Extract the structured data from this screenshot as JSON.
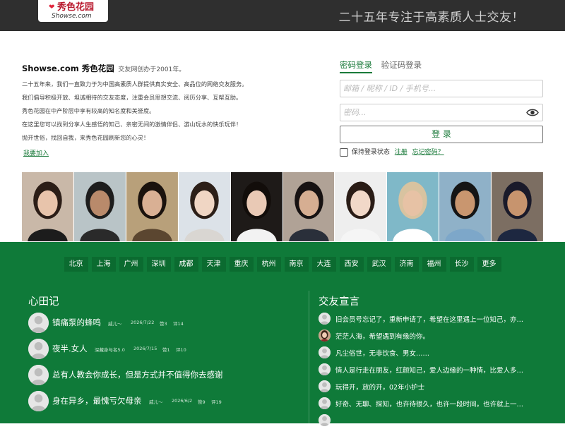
{
  "header": {
    "logo_cn": "秀色花园",
    "logo_en": "Showse.com",
    "slogan": "二十五年专注于高素质人士交友！"
  },
  "intro": {
    "title_bold": "Showse.com 秀色花园",
    "title_small": "交友网创办于2001年。",
    "paragraphs": [
      "二十五年来，我们一直致力于为中国高素质人群提供真实安全、高品位的网络交友服务。",
      "我们倡导积极开放、坦诚相待的交友态度，注重会员思想交流、阅历分享、互帮互助。",
      "秀色花园在中产阶层中享有较高的知名度和美誉度。",
      "在这里您可以找到分享人生感悟的知己、亲密无间的激情伴侣、游山玩水的快乐玩伴！",
      "抛开世俗，找回自我，来秀色花园刷新您的心灵！"
    ],
    "join_link": "我要加入"
  },
  "login": {
    "tabs": [
      "密码登录",
      "验证码登录"
    ],
    "account_placeholder": "邮箱 / 昵称 / ID / 手机号...",
    "password_placeholder": "密码...",
    "submit_label": "登 录",
    "remember_label": "保持登录状态",
    "register_link": "注册",
    "forgot_link": "忘记密码？"
  },
  "photos": [
    {
      "bg": "#c9b8a8",
      "skin": "#e8c4ab",
      "hair": "#2b1d16",
      "cloth": "#1c1c1c"
    },
    {
      "bg": "#b9c4c7",
      "skin": "#b98a6b",
      "hair": "#1d1d1d",
      "cloth": "#2a2a2a"
    },
    {
      "bg": "#b8a07a",
      "skin": "#d9b094",
      "hair": "#1a120d",
      "cloth": "#5b4630"
    },
    {
      "bg": "#dce2e8",
      "skin": "#f0d6c4",
      "hair": "#2c1f18",
      "cloth": "#d9d6d2"
    },
    {
      "bg": "#1e1a18",
      "skin": "#e9c9b5",
      "hair": "#120d0a",
      "cloth": "#f2f2f2"
    },
    {
      "bg": "#b0a296",
      "skin": "#d6ae92",
      "hair": "#171212",
      "cloth": "#2a2f3a"
    },
    {
      "bg": "#eeeeee",
      "skin": "#f1d8c8",
      "hair": "#2a1c16",
      "cloth": "#f5f5f5"
    },
    {
      "bg": "#7fb8c8",
      "skin": "#e7c2a5",
      "hair": "#d8c3a0",
      "cloth": "#ffffff"
    },
    {
      "bg": "#8fb1c8",
      "skin": "#c9966f",
      "hair": "#151515",
      "cloth": "#7da7c9"
    },
    {
      "bg": "#7c6e62",
      "skin": "#c7946e",
      "hair": "#1a1a2a",
      "cloth": "#1d2740"
    }
  ],
  "cities": [
    "北京",
    "上海",
    "广州",
    "深圳",
    "成都",
    "天津",
    "重庆",
    "杭州",
    "南京",
    "大连",
    "西安",
    "武汉",
    "济南",
    "福州",
    "长沙",
    "更多"
  ],
  "stories_section": {
    "title": "心田记",
    "items": [
      {
        "title": "镇痛泵的蜂鸣",
        "author": "戚儿～",
        "date": "2026/7/22",
        "likes": "赞3",
        "comments": "评14"
      },
      {
        "title": "夜半.女人",
        "author": "深藏身与名5.0",
        "date": "2026/7/15",
        "likes": "赞1",
        "comments": "评10"
      },
      {
        "title": "总有人教会你成长，但是方式并不值得你去感谢",
        "author": "",
        "date": "",
        "likes": "",
        "comments": ""
      },
      {
        "title": "身在异乡，最愧亏欠母亲",
        "author": "戚儿～",
        "date": "2026/6/2",
        "likes": "赞9",
        "comments": "评19"
      }
    ]
  },
  "declarations_section": {
    "title": "交友宣言",
    "items": [
      {
        "text": "旧会员号忘记了，重新申请了，希望在这里遇上一位知己，亦…",
        "avatar": "default"
      },
      {
        "text": "茫茫人海，希望遇到有缘的你。",
        "avatar": "photo"
      },
      {
        "text": "凡尘俗世，无非饮食、男女……",
        "avatar": "default"
      },
      {
        "text": "情人是行走在朋友，红颜知己，爱人边缘的一种情，比爱人多…",
        "avatar": "default"
      },
      {
        "text": "玩得开，放的开，02年小护士",
        "avatar": "default"
      },
      {
        "text": "好奇、无聊、探知，也许待很久，也许一段时间，也许就上一…",
        "avatar": "default"
      },
      {
        "text": "",
        "avatar": "default"
      }
    ]
  },
  "colors": {
    "topbar": "#2f2f2f",
    "green": "#0f7a39",
    "brand_red": "#e0253c"
  }
}
